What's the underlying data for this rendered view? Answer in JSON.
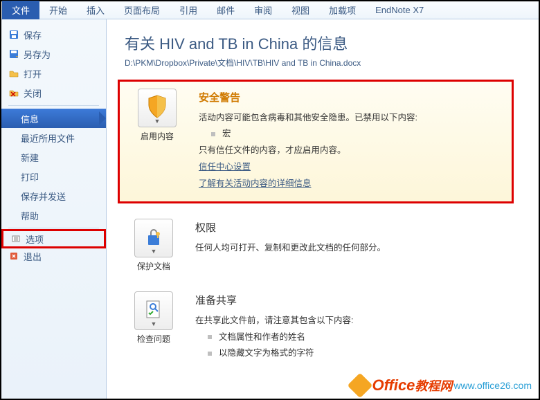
{
  "ribbon": {
    "file": "文件",
    "tabs": [
      "开始",
      "插入",
      "页面布局",
      "引用",
      "邮件",
      "审阅",
      "视图",
      "加载项",
      "EndNote X7"
    ]
  },
  "sidebar": {
    "qat": [
      {
        "label": "保存",
        "icon": "save"
      },
      {
        "label": "另存为",
        "icon": "saveas"
      },
      {
        "label": "打开",
        "icon": "open"
      },
      {
        "label": "关闭",
        "icon": "close"
      }
    ],
    "main": [
      {
        "label": "信息",
        "active": true
      },
      {
        "label": "最近所用文件"
      },
      {
        "label": "新建"
      },
      {
        "label": "打印"
      },
      {
        "label": "保存并发送"
      },
      {
        "label": "帮助"
      }
    ],
    "footer": [
      {
        "label": "选项",
        "icon": "options",
        "highlight": true
      },
      {
        "label": "退出",
        "icon": "exit"
      }
    ]
  },
  "doc": {
    "title": "有关 HIV and TB in China 的信息",
    "path": "D:\\PKM\\Dropbox\\Private\\文档\\HIV\\TB\\HIV and TB in China.docx"
  },
  "security": {
    "heading": "安全警告",
    "button": "启用内容",
    "line1": "活动内容可能包含病毒和其他安全隐患。已禁用以下内容:",
    "item": "宏",
    "line2": "只有信任文件的内容，才应启用内容。",
    "link1": "信任中心设置",
    "link2": "了解有关活动内容的详细信息"
  },
  "permissions": {
    "heading": "权限",
    "button": "保护文档",
    "text": "任何人均可打开、复制和更改此文档的任何部分。"
  },
  "share": {
    "heading": "准备共享",
    "button": "检查问题",
    "text": "在共享此文件前，请注意其包含以下内容:",
    "items": [
      "文档属性和作者的姓名",
      "以隐藏文字为格式的字符"
    ]
  },
  "watermark": {
    "brand": "Office",
    "suffix": "教程网",
    "url": "www.office26.com"
  }
}
